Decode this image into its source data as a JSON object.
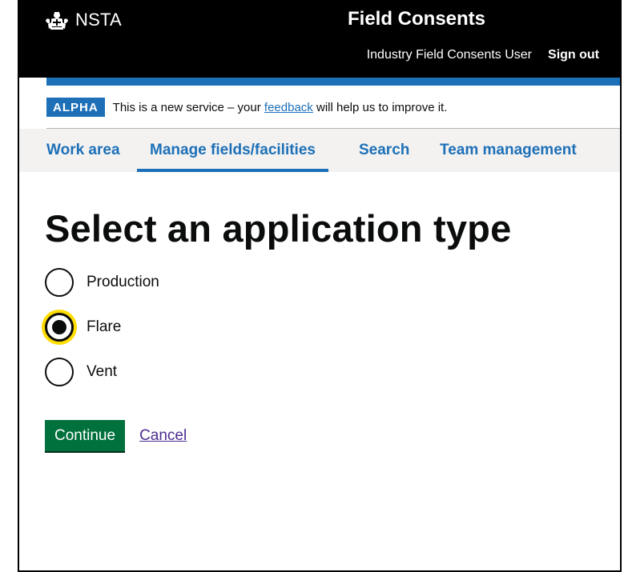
{
  "header": {
    "logo_text": "NSTA",
    "logo_icon": "crest-icon",
    "service_name": "Field Consents",
    "user_name": "Industry Field Consents User",
    "sign_out": "Sign out"
  },
  "phase_banner": {
    "tag": "ALPHA",
    "text_before": "This is a new service – your ",
    "link": "feedback",
    "text_after": " will help us to improve it."
  },
  "nav": {
    "items": [
      {
        "label": "Work area",
        "active": false
      },
      {
        "label": "Manage fields/facilities",
        "active": true
      },
      {
        "label": "Search",
        "active": false
      },
      {
        "label": "Team management",
        "active": false
      }
    ]
  },
  "main": {
    "title": "Select an application type",
    "options": [
      {
        "label": "Production",
        "checked": false
      },
      {
        "label": "Flare",
        "checked": true
      },
      {
        "label": "Vent",
        "checked": false
      }
    ],
    "continue_label": "Continue",
    "cancel_label": "Cancel"
  },
  "colors": {
    "header_bg": "#000000",
    "accent_blue": "#1d70b8",
    "nav_bg": "#f3f2f1",
    "button_green": "#00703c",
    "focus_yellow": "#ffdd00",
    "visited_link": "#4c2c92"
  }
}
